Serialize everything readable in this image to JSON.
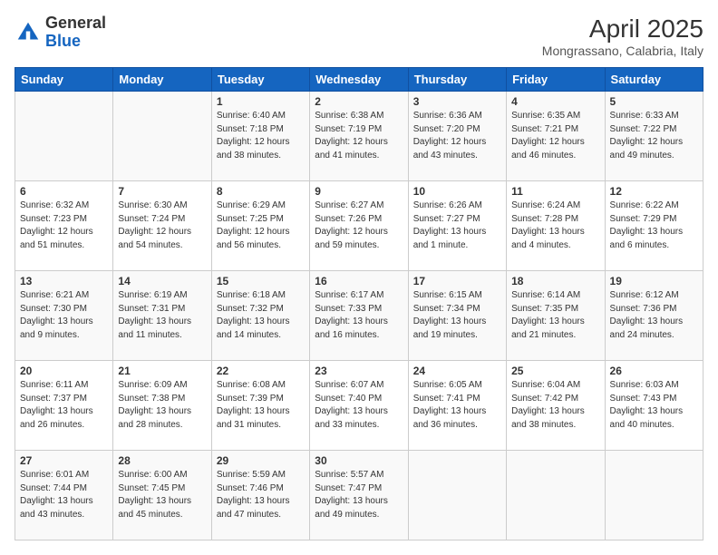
{
  "logo": {
    "line1": "General",
    "line2": "Blue"
  },
  "header": {
    "title": "April 2025",
    "location": "Mongrassano, Calabria, Italy"
  },
  "weekdays": [
    "Sunday",
    "Monday",
    "Tuesday",
    "Wednesday",
    "Thursday",
    "Friday",
    "Saturday"
  ],
  "weeks": [
    [
      {
        "day": "",
        "sunrise": "",
        "sunset": "",
        "daylight": ""
      },
      {
        "day": "",
        "sunrise": "",
        "sunset": "",
        "daylight": ""
      },
      {
        "day": "1",
        "sunrise": "Sunrise: 6:40 AM",
        "sunset": "Sunset: 7:18 PM",
        "daylight": "Daylight: 12 hours and 38 minutes."
      },
      {
        "day": "2",
        "sunrise": "Sunrise: 6:38 AM",
        "sunset": "Sunset: 7:19 PM",
        "daylight": "Daylight: 12 hours and 41 minutes."
      },
      {
        "day": "3",
        "sunrise": "Sunrise: 6:36 AM",
        "sunset": "Sunset: 7:20 PM",
        "daylight": "Daylight: 12 hours and 43 minutes."
      },
      {
        "day": "4",
        "sunrise": "Sunrise: 6:35 AM",
        "sunset": "Sunset: 7:21 PM",
        "daylight": "Daylight: 12 hours and 46 minutes."
      },
      {
        "day": "5",
        "sunrise": "Sunrise: 6:33 AM",
        "sunset": "Sunset: 7:22 PM",
        "daylight": "Daylight: 12 hours and 49 minutes."
      }
    ],
    [
      {
        "day": "6",
        "sunrise": "Sunrise: 6:32 AM",
        "sunset": "Sunset: 7:23 PM",
        "daylight": "Daylight: 12 hours and 51 minutes."
      },
      {
        "day": "7",
        "sunrise": "Sunrise: 6:30 AM",
        "sunset": "Sunset: 7:24 PM",
        "daylight": "Daylight: 12 hours and 54 minutes."
      },
      {
        "day": "8",
        "sunrise": "Sunrise: 6:29 AM",
        "sunset": "Sunset: 7:25 PM",
        "daylight": "Daylight: 12 hours and 56 minutes."
      },
      {
        "day": "9",
        "sunrise": "Sunrise: 6:27 AM",
        "sunset": "Sunset: 7:26 PM",
        "daylight": "Daylight: 12 hours and 59 minutes."
      },
      {
        "day": "10",
        "sunrise": "Sunrise: 6:26 AM",
        "sunset": "Sunset: 7:27 PM",
        "daylight": "Daylight: 13 hours and 1 minute."
      },
      {
        "day": "11",
        "sunrise": "Sunrise: 6:24 AM",
        "sunset": "Sunset: 7:28 PM",
        "daylight": "Daylight: 13 hours and 4 minutes."
      },
      {
        "day": "12",
        "sunrise": "Sunrise: 6:22 AM",
        "sunset": "Sunset: 7:29 PM",
        "daylight": "Daylight: 13 hours and 6 minutes."
      }
    ],
    [
      {
        "day": "13",
        "sunrise": "Sunrise: 6:21 AM",
        "sunset": "Sunset: 7:30 PM",
        "daylight": "Daylight: 13 hours and 9 minutes."
      },
      {
        "day": "14",
        "sunrise": "Sunrise: 6:19 AM",
        "sunset": "Sunset: 7:31 PM",
        "daylight": "Daylight: 13 hours and 11 minutes."
      },
      {
        "day": "15",
        "sunrise": "Sunrise: 6:18 AM",
        "sunset": "Sunset: 7:32 PM",
        "daylight": "Daylight: 13 hours and 14 minutes."
      },
      {
        "day": "16",
        "sunrise": "Sunrise: 6:17 AM",
        "sunset": "Sunset: 7:33 PM",
        "daylight": "Daylight: 13 hours and 16 minutes."
      },
      {
        "day": "17",
        "sunrise": "Sunrise: 6:15 AM",
        "sunset": "Sunset: 7:34 PM",
        "daylight": "Daylight: 13 hours and 19 minutes."
      },
      {
        "day": "18",
        "sunrise": "Sunrise: 6:14 AM",
        "sunset": "Sunset: 7:35 PM",
        "daylight": "Daylight: 13 hours and 21 minutes."
      },
      {
        "day": "19",
        "sunrise": "Sunrise: 6:12 AM",
        "sunset": "Sunset: 7:36 PM",
        "daylight": "Daylight: 13 hours and 24 minutes."
      }
    ],
    [
      {
        "day": "20",
        "sunrise": "Sunrise: 6:11 AM",
        "sunset": "Sunset: 7:37 PM",
        "daylight": "Daylight: 13 hours and 26 minutes."
      },
      {
        "day": "21",
        "sunrise": "Sunrise: 6:09 AM",
        "sunset": "Sunset: 7:38 PM",
        "daylight": "Daylight: 13 hours and 28 minutes."
      },
      {
        "day": "22",
        "sunrise": "Sunrise: 6:08 AM",
        "sunset": "Sunset: 7:39 PM",
        "daylight": "Daylight: 13 hours and 31 minutes."
      },
      {
        "day": "23",
        "sunrise": "Sunrise: 6:07 AM",
        "sunset": "Sunset: 7:40 PM",
        "daylight": "Daylight: 13 hours and 33 minutes."
      },
      {
        "day": "24",
        "sunrise": "Sunrise: 6:05 AM",
        "sunset": "Sunset: 7:41 PM",
        "daylight": "Daylight: 13 hours and 36 minutes."
      },
      {
        "day": "25",
        "sunrise": "Sunrise: 6:04 AM",
        "sunset": "Sunset: 7:42 PM",
        "daylight": "Daylight: 13 hours and 38 minutes."
      },
      {
        "day": "26",
        "sunrise": "Sunrise: 6:03 AM",
        "sunset": "Sunset: 7:43 PM",
        "daylight": "Daylight: 13 hours and 40 minutes."
      }
    ],
    [
      {
        "day": "27",
        "sunrise": "Sunrise: 6:01 AM",
        "sunset": "Sunset: 7:44 PM",
        "daylight": "Daylight: 13 hours and 43 minutes."
      },
      {
        "day": "28",
        "sunrise": "Sunrise: 6:00 AM",
        "sunset": "Sunset: 7:45 PM",
        "daylight": "Daylight: 13 hours and 45 minutes."
      },
      {
        "day": "29",
        "sunrise": "Sunrise: 5:59 AM",
        "sunset": "Sunset: 7:46 PM",
        "daylight": "Daylight: 13 hours and 47 minutes."
      },
      {
        "day": "30",
        "sunrise": "Sunrise: 5:57 AM",
        "sunset": "Sunset: 7:47 PM",
        "daylight": "Daylight: 13 hours and 49 minutes."
      },
      {
        "day": "",
        "sunrise": "",
        "sunset": "",
        "daylight": ""
      },
      {
        "day": "",
        "sunrise": "",
        "sunset": "",
        "daylight": ""
      },
      {
        "day": "",
        "sunrise": "",
        "sunset": "",
        "daylight": ""
      }
    ]
  ]
}
